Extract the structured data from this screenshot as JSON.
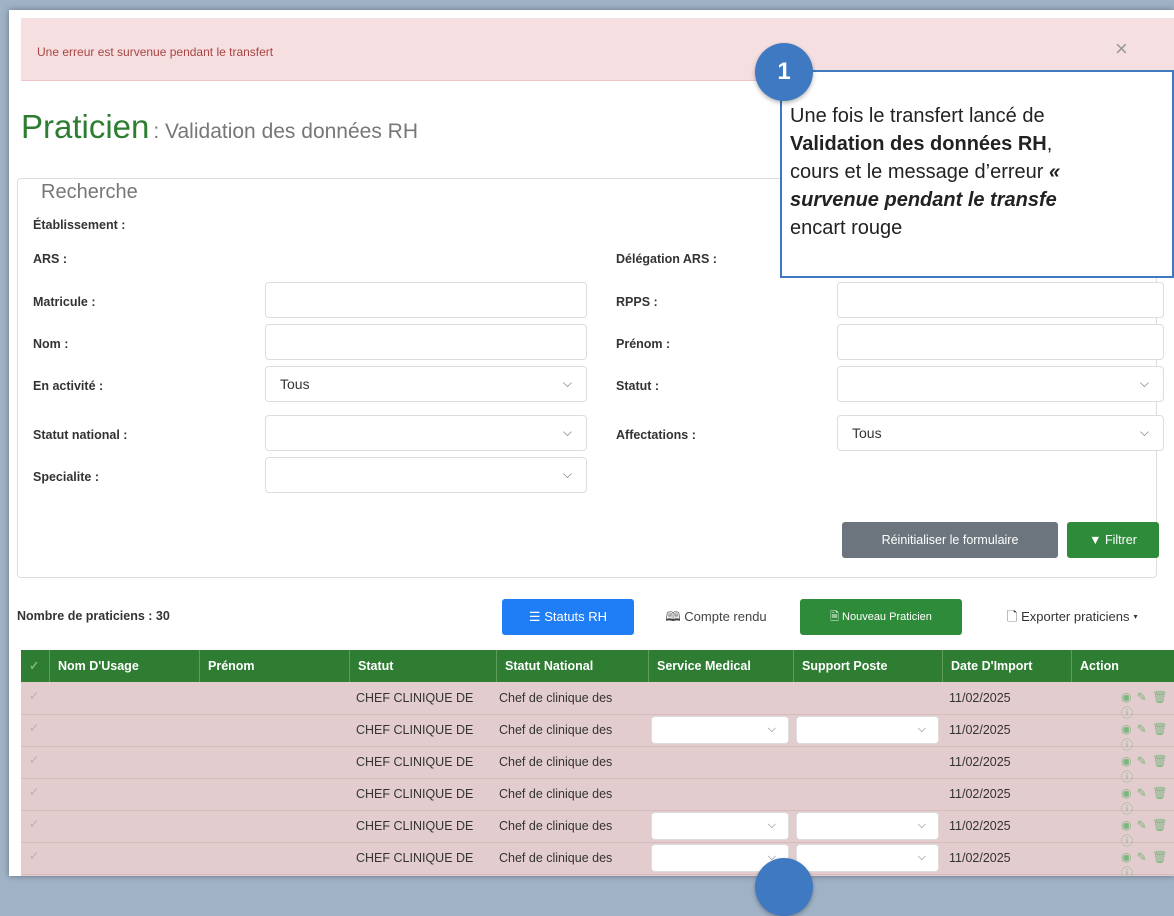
{
  "alert": {
    "message": "Une erreur est survenue pendant le transfert",
    "close": "×"
  },
  "page": {
    "title": "Praticien",
    "subtitle": ": Validation des données RH"
  },
  "search": {
    "legend": "Recherche",
    "etablissement_label": "Établissement :",
    "ars_label": "ARS :",
    "delegation_label": "Délégation ARS :",
    "matricule_label": "Matricule :",
    "rpps_label": "RPPS :",
    "nom_label": "Nom :",
    "prenom_label": "Prénom :",
    "activite_label": "En activité :",
    "activite_value": "Tous",
    "statut_label": "Statut :",
    "statut_national_label": "Statut national :",
    "affectations_label": "Affectations :",
    "affectations_value": "Tous",
    "specialite_label": "Specialite :",
    "reset_label": "Réinitialiser le formulaire",
    "filter_label": "Filtrer",
    "filter_icon": "funnel-icon"
  },
  "toolbar": {
    "count_label": "Nombre de praticiens : 30",
    "statuts_label": "Statuts RH",
    "compte_rendu_label": "Compte rendu",
    "nouveau_label": "Nouveau Praticien",
    "exporter_label": "Exporter praticiens"
  },
  "table": {
    "columns": [
      "Nom D'Usage",
      "Prénom",
      "Statut",
      "Statut National",
      "Service Medical",
      "Support Poste",
      "Date D'Import",
      "Action"
    ],
    "rows": [
      {
        "statut": "CHEF CLINIQUE DE",
        "statut_national": "Chef de clinique des",
        "date": "11/02/2025"
      },
      {
        "statut": "CHEF CLINIQUE DE",
        "statut_national": "Chef de clinique des",
        "date": "11/02/2025"
      },
      {
        "statut": "CHEF CLINIQUE DE",
        "statut_national": "Chef de clinique des",
        "date": "11/02/2025"
      },
      {
        "statut": "CHEF CLINIQUE DE",
        "statut_national": "Chef de clinique des",
        "date": "11/02/2025"
      },
      {
        "statut": "CHEF CLINIQUE DE",
        "statut_national": "Chef de clinique des",
        "date": "11/02/2025"
      },
      {
        "statut": "CHEF CLINIQUE DE",
        "statut_national": "Chef de clinique des",
        "date": "11/02/2025"
      }
    ],
    "action_icons": "◉ ✎ 🗑 ⓘ"
  },
  "callout": {
    "badge": "1",
    "line1": "Une fois le transfert lancé de",
    "line2_bold": "Validation des données RH",
    "line2_rest": ",",
    "line3_plain": "cours et le message d’erreur",
    "line3_italic": " «",
    "line4_italic_bold": "survenue pendant le transfe",
    "line5": "encart rouge"
  },
  "colors": {
    "brand_green": "#2e7d32",
    "alert_bg": "#f6dfe0",
    "callout_blue": "#3e79c2",
    "primary_blue": "#1f7df5"
  }
}
